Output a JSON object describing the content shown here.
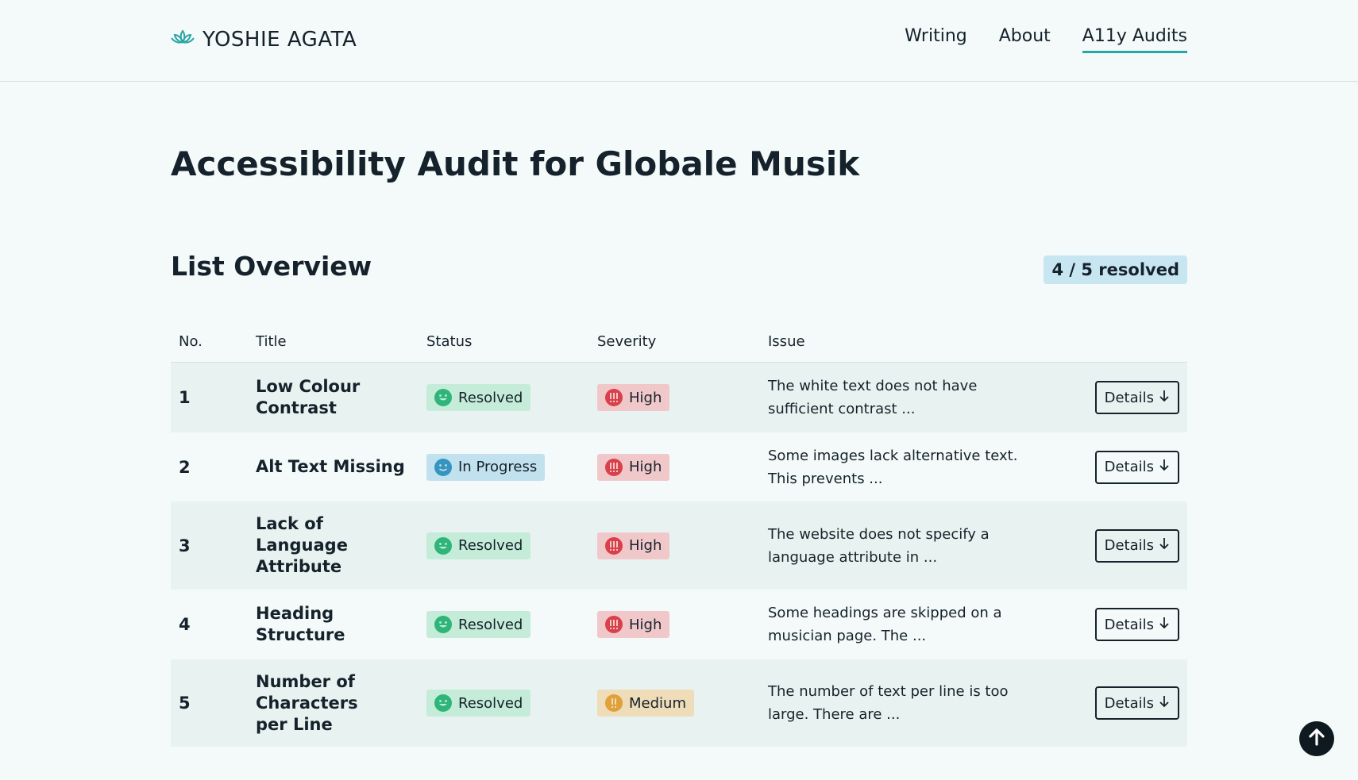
{
  "header": {
    "brand": "YOSHIE AGATA",
    "nav": [
      {
        "label": "Writing",
        "active": false
      },
      {
        "label": "About",
        "active": false
      },
      {
        "label": "A11y Audits",
        "active": true
      }
    ]
  },
  "page_title": "Accessibility Audit for Globale Musik",
  "overview": {
    "heading": "List Overview",
    "resolved_count": "4 / 5 resolved"
  },
  "table": {
    "columns": [
      "No.",
      "Title",
      "Status",
      "Severity",
      "Issue"
    ],
    "details_label": "Details",
    "rows": [
      {
        "no": "1",
        "title": "Low Colour Contrast",
        "status": "Resolved",
        "severity": "High",
        "issue": "The white text does not have sufficient contrast ..."
      },
      {
        "no": "2",
        "title": "Alt Text Missing",
        "status": "In Progress",
        "severity": "High",
        "issue": "Some images lack alternative text. This prevents ..."
      },
      {
        "no": "3",
        "title": "Lack of Language Attribute",
        "status": "Resolved",
        "severity": "High",
        "issue": "The website does not specify a language attribute in ..."
      },
      {
        "no": "4",
        "title": "Heading Structure",
        "status": "Resolved",
        "severity": "High",
        "issue": "Some headings are skipped on a musician page. The ..."
      },
      {
        "no": "5",
        "title": "Number of Characters per Line",
        "status": "Resolved",
        "severity": "Medium",
        "issue": "The number of text per line is too large. There are ..."
      }
    ]
  },
  "colors": {
    "accent": "#2aa6a5",
    "resolved_bg": "#c5ecd9",
    "resolved_icon": "#2fb57a",
    "inprogress_bg": "#c2e1ef",
    "inprogress_icon": "#3594c0",
    "high_bg": "#f1c8ca",
    "high_icon": "#d9404a",
    "medium_bg": "#efdcb8",
    "medium_icon": "#e0a03a"
  },
  "icons": {
    "brand": "lotus-icon",
    "resolved": "smile-icon",
    "in_progress": "smile-icon",
    "high": "exclamation-triple-icon",
    "medium": "exclamation-double-icon",
    "details": "arrow-down-icon",
    "back_to_top": "arrow-up-icon"
  }
}
